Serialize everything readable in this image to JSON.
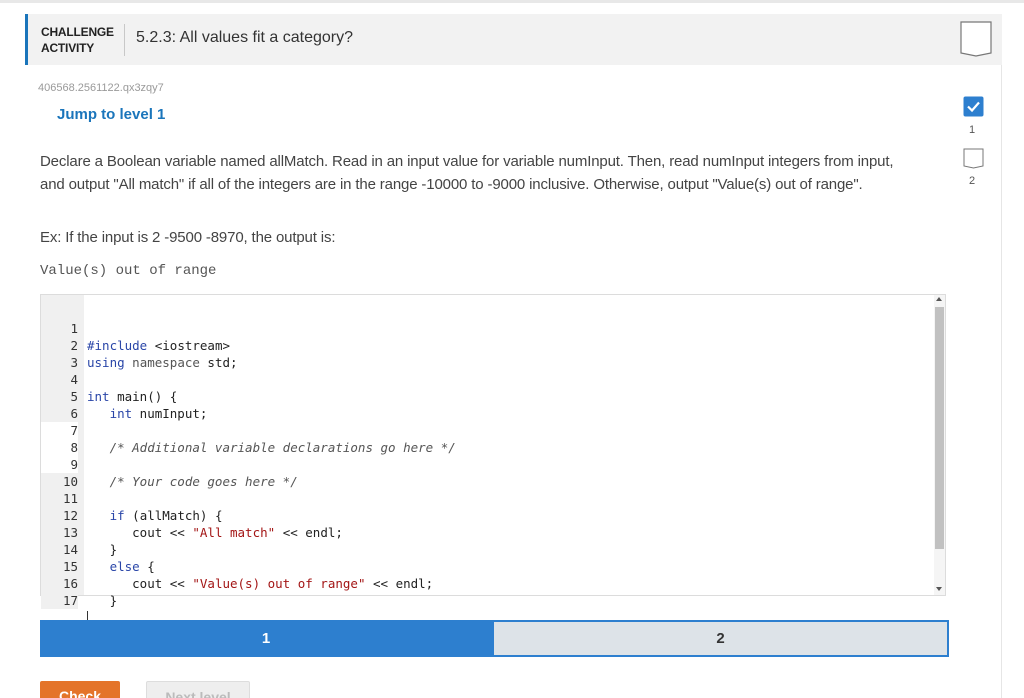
{
  "header": {
    "badge_line1": "CHALLENGE",
    "badge_line2": "ACTIVITY",
    "title": "5.2.3: All values fit a category?"
  },
  "activity_id": "406568.2561122.qx3zqy7",
  "jump_label": "Jump to level 1",
  "prompt": "Declare a Boolean variable named allMatch. Read in an input value for variable numInput. Then, read numInput integers from input, and output \"All match\" if all of the integers are in the range -10000 to -9000 inclusive. Otherwise, output \"Value(s) out of range\".",
  "example": "Ex: If the input is 2 -9500 -8970, the output is:",
  "example_output": "Value(s) out of range",
  "code": {
    "line_numbers": [
      "1",
      "2",
      "3",
      "4",
      "5",
      "6",
      "7",
      "8",
      "9",
      "10",
      "11",
      "12",
      "13",
      "14",
      "15",
      "16",
      "17"
    ],
    "l1_kw": "#include",
    "l1_rest": " <iostream>",
    "l2_kw": "using",
    "l2_kw2": "namespace",
    "l2_rest": " std;",
    "l4_kw": "int",
    "l4_rest": " main() {",
    "l5_kw": "int",
    "l5_rest": " numInput;",
    "l7_comment": "/* Additional variable declarations go here */",
    "l9_comment": "/* Your code goes here */",
    "l11_kw": "if",
    "l11_rest": " (allMatch) {",
    "l12_a": "cout << ",
    "l12_str": "\"All match\"",
    "l12_b": " << endl;",
    "l13": "}",
    "l14_kw": "else",
    "l14_rest": " {",
    "l15_a": "cout << ",
    "l15_str": "\"Value(s) out of range\"",
    "l15_b": " << endl;",
    "l16": "}"
  },
  "levels": [
    {
      "label": "1",
      "state": "active"
    },
    {
      "label": "2",
      "state": "locked"
    }
  ],
  "buttons": {
    "check": "Check",
    "next_level": "Next level"
  },
  "side_levels": [
    {
      "label": "1",
      "completed": true
    },
    {
      "label": "2",
      "completed": false
    }
  ],
  "colors": {
    "accent": "#1a75bb",
    "level_active": "#2d7fcf",
    "check_button": "#e4742a",
    "completed_check": "#2d7fcf"
  }
}
